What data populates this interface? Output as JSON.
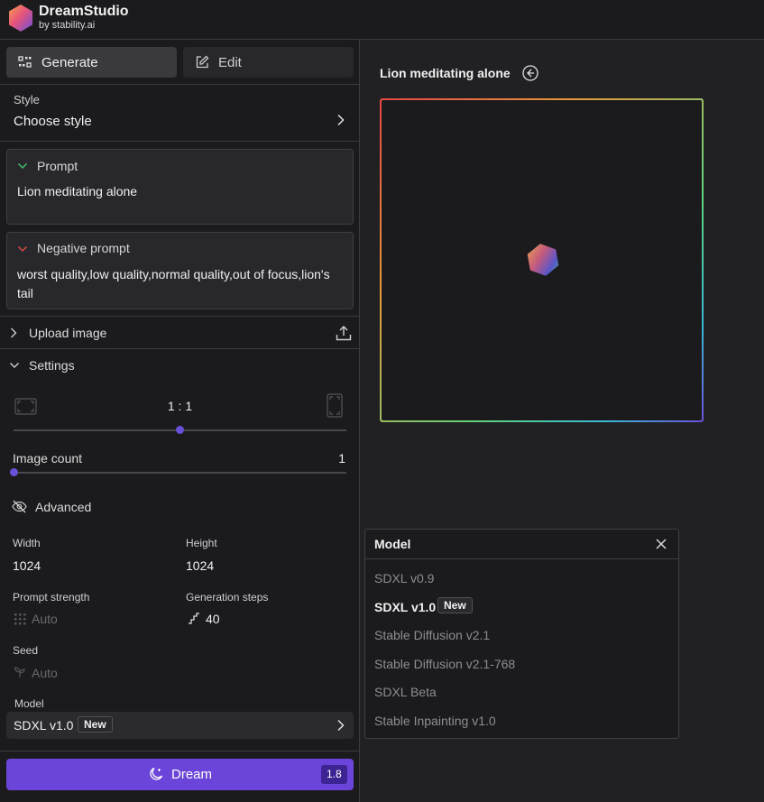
{
  "app": {
    "name": "DreamStudio",
    "sub": "by stability.ai"
  },
  "tabs": {
    "generate": "Generate",
    "edit": "Edit"
  },
  "style": {
    "label": "Style",
    "value": "Choose style"
  },
  "prompt": {
    "title": "Prompt",
    "text": "Lion meditating alone"
  },
  "negative": {
    "title": "Negative prompt",
    "text": "worst quality,low quality,normal quality,out of focus,lion's tail"
  },
  "upload": {
    "label": "Upload image"
  },
  "settings": {
    "label": "Settings",
    "aspect_ratio": "1 : 1",
    "aspect_level": 0.5,
    "image_count_label": "Image count",
    "image_count": "1",
    "image_count_level": 0.0
  },
  "advanced": {
    "label": "Advanced",
    "width_label": "Width",
    "width": "1024",
    "height_label": "Height",
    "height": "1024",
    "prompt_strength_label": "Prompt strength",
    "prompt_strength": "Auto",
    "steps_label": "Generation steps",
    "steps": "40",
    "seed_label": "Seed",
    "seed": "Auto"
  },
  "model": {
    "label": "Model",
    "value": "SDXL v1.0",
    "badge": "New"
  },
  "dream": {
    "label": "Dream",
    "cost": "1.8"
  },
  "main": {
    "prompt_title": "Lion meditating alone"
  },
  "model_dropdown": {
    "title": "Model",
    "badge": "New",
    "items": [
      "SDXL v0.9",
      "SDXL v1.0",
      "Stable Diffusion v2.1",
      "Stable Diffusion v2.1-768",
      "SDXL Beta",
      "Stable Inpainting v1.0"
    ],
    "selected": "SDXL v1.0"
  },
  "colors": {
    "accent": "#6b45d9",
    "panel": "#1b1b1e",
    "background": "#212124"
  }
}
